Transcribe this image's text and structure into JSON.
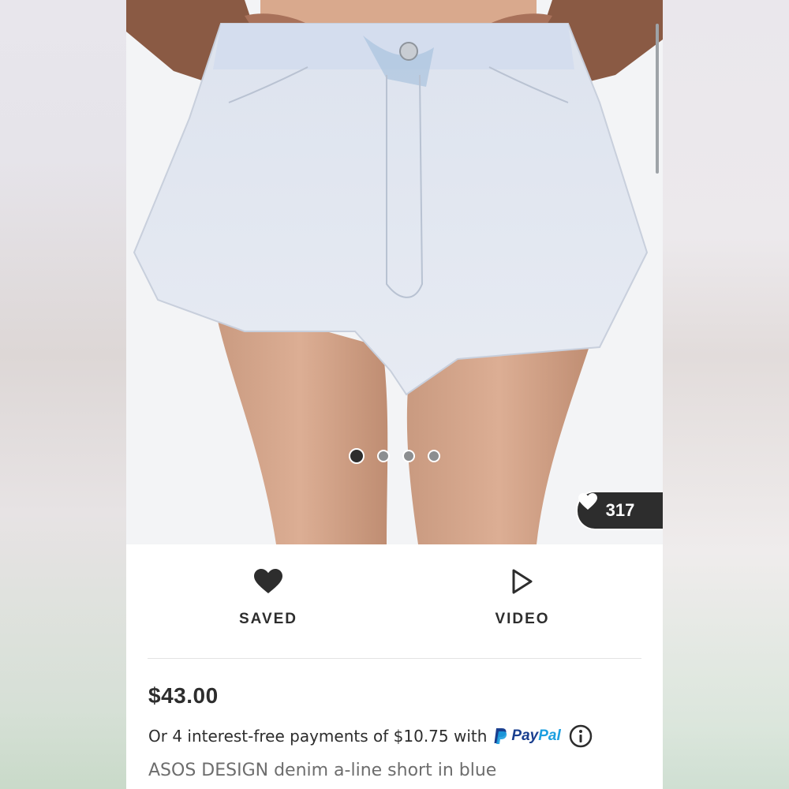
{
  "gallery": {
    "slide_count": 4,
    "active_index": 0,
    "likes_count": "317"
  },
  "actions": {
    "saved_label": "SAVED",
    "video_label": "VIDEO"
  },
  "product": {
    "price": "$43.00",
    "installment_text": "Or 4 interest-free payments of $10.75 with",
    "paypal_pay": "Pay",
    "paypal_pal": "Pal",
    "name": "ASOS DESIGN denim a-line short in blue"
  },
  "colors": {
    "text_dark": "#2d2d2d",
    "text_muted": "#6d6d6d",
    "paypal_dark": "#1a3f8f",
    "paypal_light": "#1c9fe0"
  },
  "icons": {
    "saved": "heart-filled-icon",
    "video": "play-outline-icon",
    "likes": "heart-icon",
    "info": "info-circle-icon",
    "paypal": "paypal-logo-icon"
  }
}
